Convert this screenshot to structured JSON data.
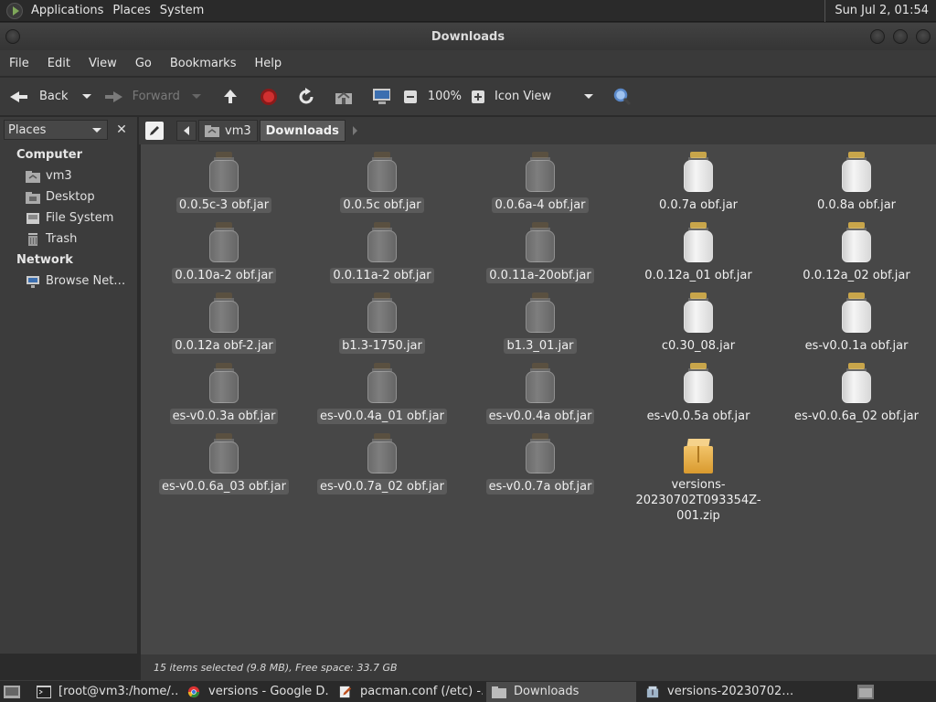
{
  "top_panel": {
    "menus": [
      "Applications",
      "Places",
      "System"
    ],
    "clock": "Sun Jul  2, 01:54"
  },
  "window": {
    "title": "Downloads"
  },
  "menubar": [
    "File",
    "Edit",
    "View",
    "Go",
    "Bookmarks",
    "Help"
  ],
  "toolbar": {
    "back": "Back",
    "forward": "Forward",
    "zoom": "100%",
    "view_mode": "Icon View"
  },
  "sidebar": {
    "selector": "Places",
    "groups": [
      {
        "label": "Computer",
        "items": [
          {
            "label": "vm3",
            "icon": "home-folder-icon"
          },
          {
            "label": "Desktop",
            "icon": "desktop-icon"
          },
          {
            "label": "File System",
            "icon": "drive-icon"
          },
          {
            "label": "Trash",
            "icon": "trash-icon"
          }
        ]
      },
      {
        "label": "Network",
        "items": [
          {
            "label": "Browse Net…",
            "icon": "network-icon"
          }
        ]
      }
    ]
  },
  "pathbar": {
    "crumbs": [
      "vm3",
      "Downloads"
    ]
  },
  "files": [
    {
      "name": "0.0.5c-3 obf.jar",
      "selected": true
    },
    {
      "name": "0.0.5c obf.jar",
      "selected": true
    },
    {
      "name": "0.0.6a-4 obf.jar",
      "selected": true
    },
    {
      "name": "0.0.7a obf.jar",
      "selected": false
    },
    {
      "name": "0.0.8a obf.jar",
      "selected": false
    },
    {
      "name": "0.0.10a-2 obf.jar",
      "selected": true
    },
    {
      "name": "0.0.11a-2 obf.jar",
      "selected": true
    },
    {
      "name": "0.0.11a-20obf.jar",
      "selected": true
    },
    {
      "name": "0.0.12a_01 obf.jar",
      "selected": false
    },
    {
      "name": "0.0.12a_02 obf.jar",
      "selected": false
    },
    {
      "name": "0.0.12a obf-2.jar",
      "selected": true
    },
    {
      "name": "b1.3-1750.jar",
      "selected": true
    },
    {
      "name": "b1.3_01.jar",
      "selected": true
    },
    {
      "name": "c0.30_08.jar",
      "selected": false
    },
    {
      "name": "es-v0.0.1a obf.jar",
      "selected": false
    },
    {
      "name": "es-v0.0.3a obf.jar",
      "selected": true
    },
    {
      "name": "es-v0.0.4a_01 obf.jar",
      "selected": true
    },
    {
      "name": "es-v0.0.4a obf.jar",
      "selected": true
    },
    {
      "name": "es-v0.0.5a obf.jar",
      "selected": false
    },
    {
      "name": "es-v0.0.6a_02 obf.jar",
      "selected": false
    },
    {
      "name": "es-v0.0.6a_03 obf.jar",
      "selected": true
    },
    {
      "name": "es-v0.0.7a_02 obf.jar",
      "selected": true
    },
    {
      "name": "es-v0.0.7a obf.jar",
      "selected": true
    },
    {
      "name": "versions-\n20230702T093354Z-\n001.zip",
      "selected": false,
      "type": "zip"
    }
  ],
  "statusbar": "15 items selected (9.8 MB), Free space: 33.7 GB",
  "taskbar": [
    {
      "label": "[root@vm3:/home/…",
      "icon": "terminal-icon",
      "active": false
    },
    {
      "label": "versions - Google D…",
      "icon": "chrome-icon",
      "active": false
    },
    {
      "label": "pacman.conf (/etc) -…",
      "icon": "text-editor-icon",
      "active": false
    },
    {
      "label": "Downloads",
      "icon": "folder-icon",
      "active": true
    },
    {
      "label": "versions-20230702…",
      "icon": "archive-manager-icon",
      "active": false
    }
  ]
}
